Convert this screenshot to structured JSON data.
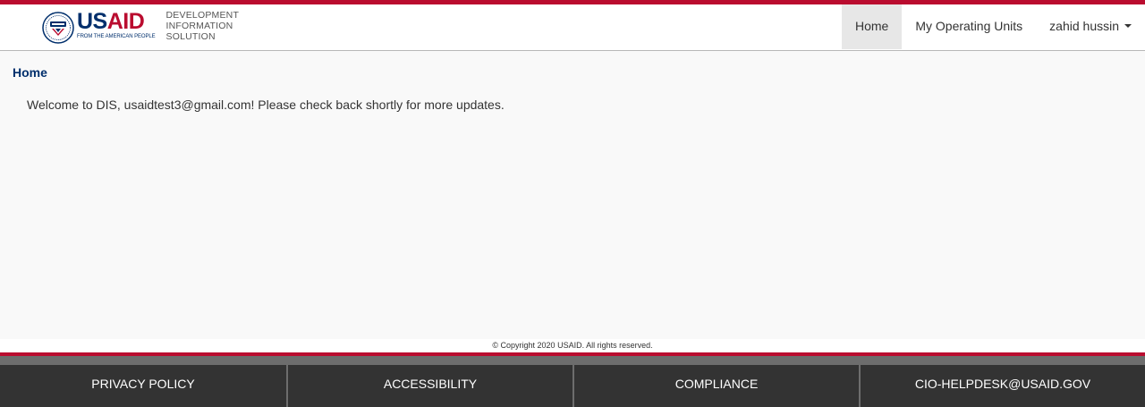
{
  "header": {
    "logo_wordmark_us": "US",
    "logo_wordmark_aid": "AID",
    "logo_tagline": "FROM THE AMERICAN PEOPLE",
    "brand_lines": [
      "DEVELOPMENT",
      "INFORMATION",
      "SOLUTION"
    ],
    "nav": [
      {
        "label": "Home",
        "active": true
      },
      {
        "label": "My Operating Units",
        "active": false
      },
      {
        "label": "zahid hussin",
        "active": false,
        "dropdown": true
      }
    ]
  },
  "breadcrumb": "Home",
  "main": {
    "welcome_text": "Welcome to DIS, usaidtest3@gmail.com! Please check back shortly for more updates."
  },
  "footer": {
    "copyright": "© Copyright 2020 USAID. All rights reserved.",
    "links": [
      "PRIVACY POLICY",
      "ACCESSIBILITY",
      "COMPLIANCE",
      "CIO-HELPDESK@USAID.GOV"
    ]
  },
  "colors": {
    "brand_blue": "#002f6c",
    "brand_red": "#ba0c2f",
    "footer_dark": "#333333",
    "footer_gray": "#6d6d6d",
    "nav_active_bg": "#e7e7e7"
  },
  "icons": [
    "usaid-seal-icon",
    "caret-down-icon"
  ]
}
